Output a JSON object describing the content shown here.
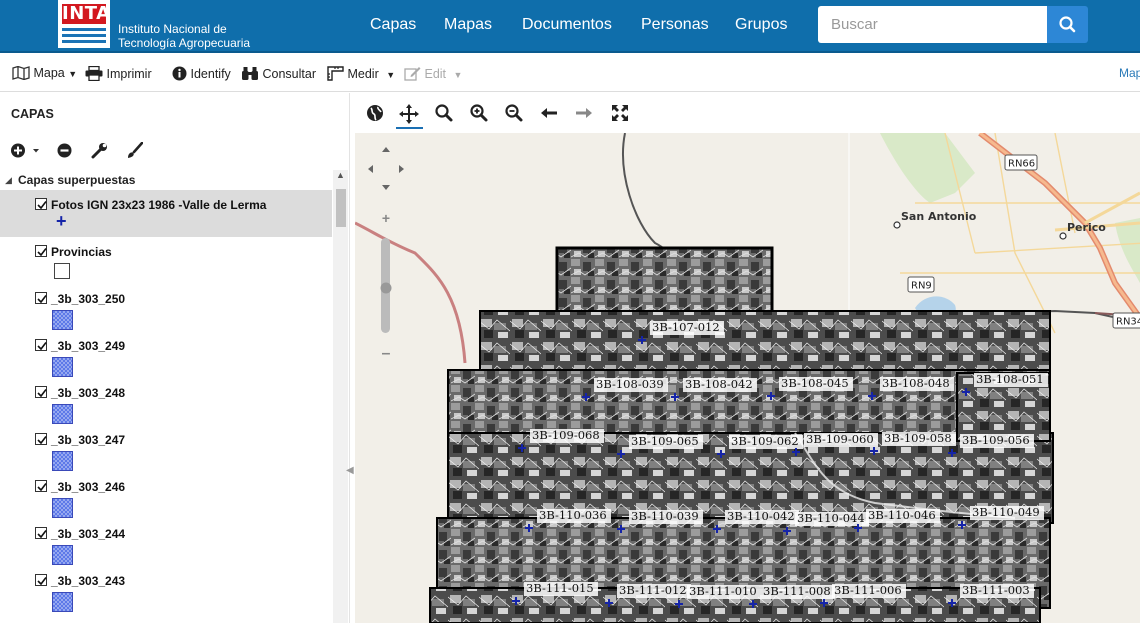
{
  "header": {
    "logo_text": "INTA",
    "org_line1": "Instituto Nacional de",
    "org_line2": "Tecnología Agropecuaria",
    "nav": [
      "Capas",
      "Mapas",
      "Documentos",
      "Personas",
      "Grupos"
    ],
    "search_placeholder": "Buscar"
  },
  "toolbar": {
    "mapa": "Mapa",
    "imprimir": "Imprimir",
    "identify": "Identify",
    "consultar": "Consultar",
    "medir": "Medir",
    "edit": "Edit",
    "right_link": "Map"
  },
  "sidebar": {
    "title": "CAPAS",
    "group": "Capas superpuestas",
    "layers": [
      {
        "name": "Fotos IGN 23x23 1986 -Valle de Lerma",
        "checked": true
      },
      {
        "name": "Provincias",
        "checked": true
      },
      {
        "name": "_3b_303_250",
        "checked": true
      },
      {
        "name": "_3b_303_249",
        "checked": true
      },
      {
        "name": "_3b_303_248",
        "checked": true
      },
      {
        "name": "_3b_303_247",
        "checked": true
      },
      {
        "name": "_3b_303_246",
        "checked": true
      },
      {
        "name": "_3b_303_244",
        "checked": true
      },
      {
        "name": "_3b_303_243",
        "checked": true
      }
    ]
  },
  "map": {
    "places": [
      "San Antonio",
      "Perico"
    ],
    "roads": [
      "RN66",
      "RN9",
      "RN34"
    ],
    "photo_labels": [
      "3B-107-012",
      "3B-108-039",
      "3B-108-042",
      "3B-108-045",
      "3B-108-048",
      "3B-108-051",
      "3B-109-068",
      "3B-109-065",
      "3B-109-062",
      "3B-109-060",
      "3B-109-058",
      "3B-109-056",
      "3B-110-036",
      "3B-110-039",
      "3B-110-042",
      "3B-110-044",
      "3B-110-046",
      "3B-110-049",
      "3B-111-015",
      "3B-111-012",
      "3B-111-010",
      "3B-111-008",
      "3B-111-006",
      "3B-111-003"
    ]
  },
  "colors": {
    "header": "#0f6eab",
    "search_button": "#2d87d6",
    "layer_swatch": "#5d79e8",
    "marker": "#1524a8"
  }
}
